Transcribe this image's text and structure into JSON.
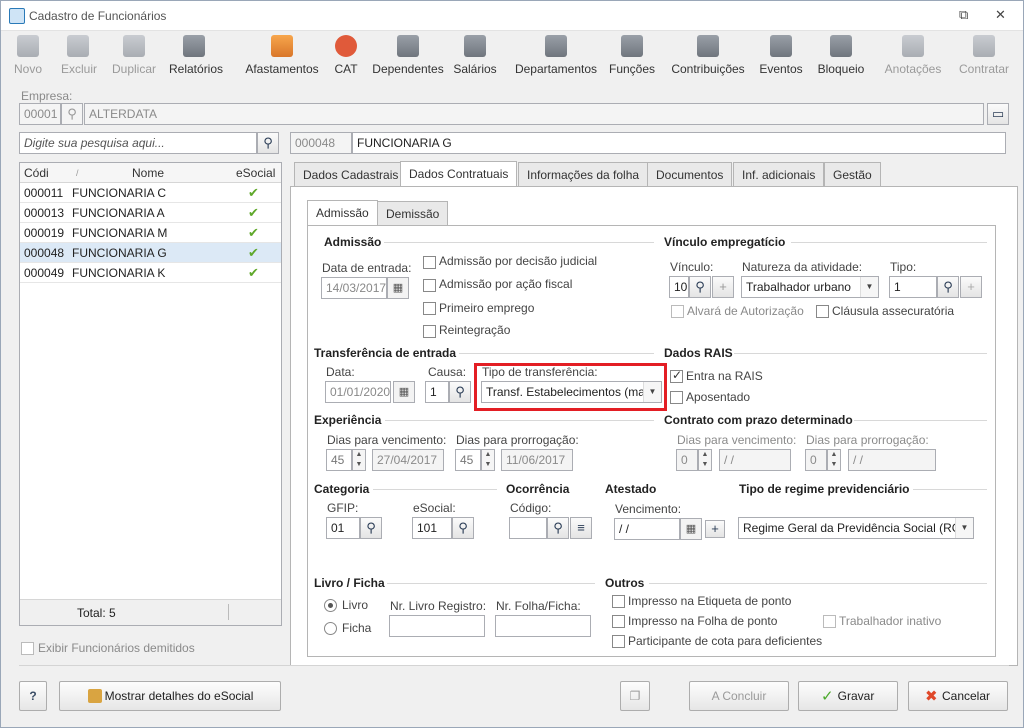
{
  "window": {
    "title": "Cadastro de Funcionários"
  },
  "toolbar": [
    {
      "label": "Novo",
      "icon": "new-user-icon",
      "enabled": false
    },
    {
      "label": "Excluir",
      "icon": "trash-icon",
      "enabled": false
    },
    {
      "label": "Duplicar",
      "icon": "duplicate-icon",
      "enabled": false
    },
    {
      "label": "Relatórios",
      "icon": "report-icon",
      "enabled": true
    },
    {
      "label": "Afastamentos",
      "icon": "house-arrow-icon",
      "enabled": true
    },
    {
      "label": "CAT",
      "icon": "medical-cross-icon",
      "enabled": true
    },
    {
      "label": "Dependentes",
      "icon": "people-icon",
      "enabled": true
    },
    {
      "label": "Salários",
      "icon": "money-icon",
      "enabled": true
    },
    {
      "label": "Departamentos",
      "icon": "desk-icon",
      "enabled": true
    },
    {
      "label": "Funções",
      "icon": "badge-icon",
      "enabled": true
    },
    {
      "label": "Contribuições",
      "icon": "contribution-icon",
      "enabled": true
    },
    {
      "label": "Eventos",
      "icon": "list-icon",
      "enabled": true
    },
    {
      "label": "Bloqueio",
      "icon": "lock-icon",
      "enabled": true
    },
    {
      "label": "Anotações",
      "icon": "note-icon",
      "enabled": false
    },
    {
      "label": "Contratar",
      "icon": "hire-icon",
      "enabled": false
    }
  ],
  "empresa": {
    "label": "Empresa:",
    "code": "00001",
    "name": "ALTERDATA"
  },
  "search": {
    "placeholder": "Digite sua pesquisa aqui..."
  },
  "employee": {
    "code": "000048",
    "name": "FUNCIONARIA G"
  },
  "grid": {
    "columns": [
      "Códi",
      "Nome",
      "eSocial"
    ],
    "rows": [
      {
        "code": "000011",
        "name": "FUNCIONARIA C"
      },
      {
        "code": "000013",
        "name": "FUNCIONARIA A"
      },
      {
        "code": "000019",
        "name": "FUNCIONARIA M"
      },
      {
        "code": "000048",
        "name": "FUNCIONARIA G"
      },
      {
        "code": "000049",
        "name": "FUNCIONARIA K"
      }
    ],
    "total": "Total: 5"
  },
  "show_dismissed": "Exibir Funcionários demitidos",
  "tabs": [
    "Dados Cadastrais",
    "Dados Contratuais",
    "Informações da folha",
    "Documentos",
    "Inf. adicionais",
    "Gestão"
  ],
  "subtabs": [
    "Admissão",
    "Demissão"
  ],
  "admissao": {
    "title": "Admissão",
    "date_label": "Data de entrada:",
    "date_value": "14/03/2017",
    "checks": [
      "Admissão por decisão judicial",
      "Admissão por ação fiscal",
      "Primeiro emprego",
      "Reintegração"
    ]
  },
  "vinculo": {
    "title": "Vínculo empregatício",
    "vinculo_label": "Vínculo:",
    "vinculo_value": "10",
    "natureza_label": "Natureza da atividade:",
    "natureza_value": "Trabalhador urbano",
    "tipo_label": "Tipo:",
    "tipo_value": "1",
    "alvara": "Alvará de Autorização",
    "clausula": "Cláusula assecuratória"
  },
  "transferencia": {
    "title": "Transferência de entrada",
    "data_label": "Data:",
    "data_value": "01/01/2020",
    "causa_label": "Causa:",
    "causa_value": "1",
    "tipo_label": "Tipo de transferência:",
    "tipo_value": "Transf. Estabelecimentos (ma"
  },
  "rais": {
    "title": "Dados RAIS",
    "entra": "Entra na RAIS",
    "aposentado": "Aposentado"
  },
  "experiencia": {
    "title": "Experiência",
    "venc_label": "Dias para vencimento:",
    "venc_days": "45",
    "venc_date": "27/04/2017",
    "prorr_label": "Dias para prorrogação:",
    "prorr_days": "45",
    "prorr_date": "11/06/2017"
  },
  "contrato": {
    "title": "Contrato com prazo determinado",
    "venc_label": "Dias para vencimento:",
    "venc_days": "0",
    "venc_date": "/ /",
    "prorr_label": "Dias para prorrogação:",
    "prorr_days": "0",
    "prorr_date": "/ /"
  },
  "categoria": {
    "title": "Categoria",
    "gfip_label": "GFIP:",
    "gfip_value": "01",
    "esocial_label": "eSocial:",
    "esocial_value": "101"
  },
  "ocorrencia": {
    "title": "Ocorrência",
    "codigo_label": "Código:",
    "codigo_value": ""
  },
  "atestado": {
    "title": "Atestado",
    "venc_label": "Vencimento:",
    "venc_value": "/ /"
  },
  "regime": {
    "title": "Tipo de regime previdenciário",
    "value": "Regime Geral da Previdência Social (RGPS"
  },
  "livro": {
    "title": "Livro / Ficha",
    "opt_livro": "Livro",
    "opt_ficha": "Ficha",
    "reg_label": "Nr. Livro Registro:",
    "folha_label": "Nr. Folha/Ficha:"
  },
  "outros": {
    "title": "Outros",
    "etiqueta": "Impresso na Etiqueta de ponto",
    "folha": "Impresso na Folha de ponto",
    "deficientes": "Participante de cota para deficientes",
    "inativo": "Trabalhador inativo"
  },
  "footer": {
    "help": "?",
    "details": "Mostrar detalhes do eSocial",
    "concluir": "A Concluir",
    "gravar": "Gravar",
    "cancelar": "Cancelar"
  }
}
